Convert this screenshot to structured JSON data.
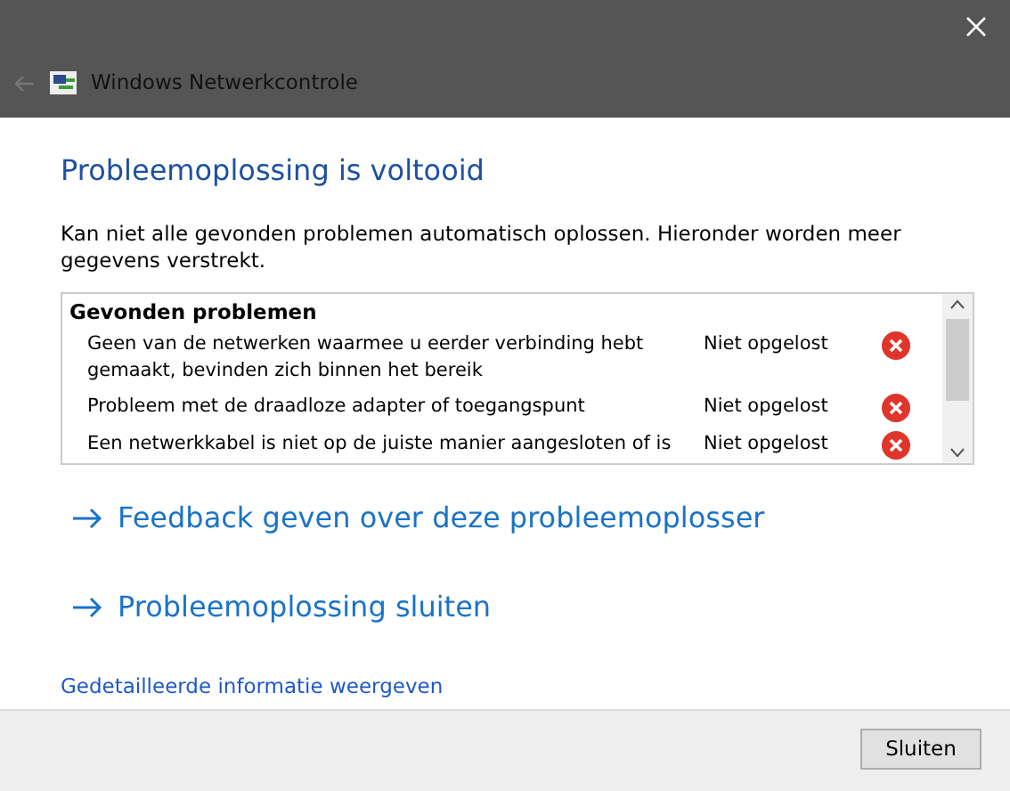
{
  "window": {
    "title": "Windows Netwerkcontrole"
  },
  "heading": "Probleemoplossing is voltooid",
  "description": "Kan niet alle gevonden problemen automatisch oplossen. Hieronder worden meer gegevens verstrekt.",
  "problems": {
    "title": "Gevonden problemen",
    "rows": [
      {
        "description": "Geen van de netwerken waarmee u eerder verbinding hebt gemaakt, bevinden zich binnen het bereik",
        "status": "Niet opgelost"
      },
      {
        "description": "Probleem met de draadloze adapter of toegangspunt",
        "status": "Niet opgelost"
      },
      {
        "description": "Een netwerkkabel is niet op de juiste manier aangesloten of is",
        "status": "Niet opgelost"
      }
    ]
  },
  "actions": [
    "Feedback geven over deze probleemoplosser",
    "Probleemoplossing sluiten"
  ],
  "details_link": "Gedetailleerde informatie weergeven",
  "buttons": [
    "Sluiten"
  ]
}
